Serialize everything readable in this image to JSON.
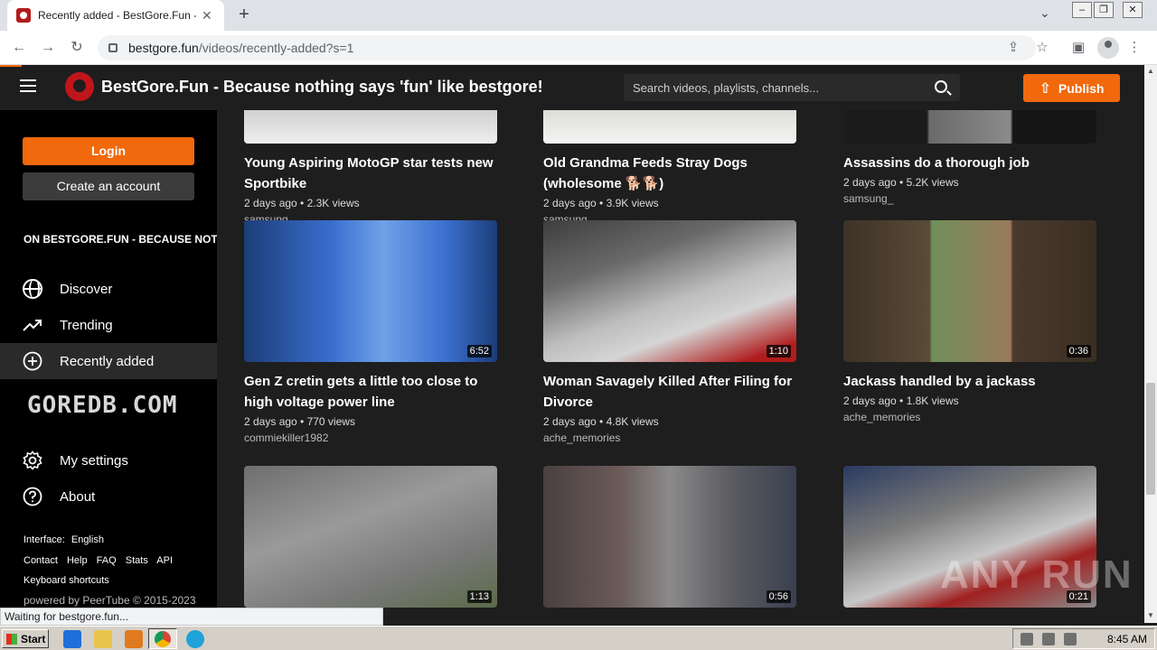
{
  "browser": {
    "tab_title": "Recently added - BestGore.Fun - Be",
    "tab_close": "✕",
    "new_tab": "+",
    "url_domain": "bestgore.fun",
    "url_path": "/videos/recently-added?s=1",
    "status_text": "Waiting for bestgore.fun..."
  },
  "header": {
    "site_title": "BestGore.Fun - Because nothing says 'fun' like bestgore!",
    "search_placeholder": "Search videos, playlists, channels...",
    "publish_label": "Publish",
    "accent": "#f1680d"
  },
  "sidebar": {
    "login_label": "Login",
    "create_account_label": "Create an account",
    "instance_name": "ON BESTGORE.FUN - BECAUSE NOTHING SAYS 'FUN' LIKE BESTGORE!",
    "items": [
      {
        "label": "Discover",
        "icon": "globe-icon"
      },
      {
        "label": "Trending",
        "icon": "trending-icon"
      },
      {
        "label": "Recently added",
        "icon": "add-circle-icon",
        "active": true
      }
    ],
    "banner_text": "GOREDB.COM",
    "settings_items": [
      {
        "label": "My settings",
        "icon": "gear-icon"
      },
      {
        "label": "About",
        "icon": "help-icon"
      }
    ],
    "interface_label": "Interface:",
    "interface_value": "English",
    "footer_links": [
      "Contact",
      "Help",
      "FAQ",
      "Stats",
      "API"
    ],
    "shortcuts_label": "Keyboard shortcuts",
    "powered_by": "powered by PeerTube © 2015-2023"
  },
  "videos": [
    {
      "title": "Young Aspiring MotoGP star tests new Sportbike",
      "meta": "2 days ago • 2.3K views",
      "channel": "samsung_",
      "duration": ""
    },
    {
      "title": "Old Grandma Feeds Stray Dogs (wholesome 🐕🐕)",
      "meta": "2 days ago • 3.9K views",
      "channel": "samsung_",
      "duration": ""
    },
    {
      "title": "Assassins do a thorough job",
      "meta": "2 days ago • 5.2K views",
      "channel": "samsung_",
      "duration": ""
    },
    {
      "title": "Gen Z cretin gets a little too close to high voltage power line",
      "meta": "2 days ago • 770 views",
      "channel": "commiekiller1982",
      "duration": "6:52"
    },
    {
      "title": "Woman Savagely Killed After Filing for Divorce",
      "meta": "2 days ago • 4.8K views",
      "channel": "ache_memories",
      "duration": "1:10"
    },
    {
      "title": "Jackass handled by a jackass",
      "meta": "2 days ago • 1.8K views",
      "channel": "ache_memories",
      "duration": "0:36"
    },
    {
      "title": "",
      "meta": "",
      "channel": "",
      "duration": "1:13"
    },
    {
      "title": "",
      "meta": "",
      "channel": "",
      "duration": "0:56"
    },
    {
      "title": "",
      "meta": "",
      "channel": "",
      "duration": "0:21"
    }
  ],
  "watermark": "ANY RUN",
  "taskbar": {
    "start_label": "Start",
    "clock": "8:45 AM"
  }
}
